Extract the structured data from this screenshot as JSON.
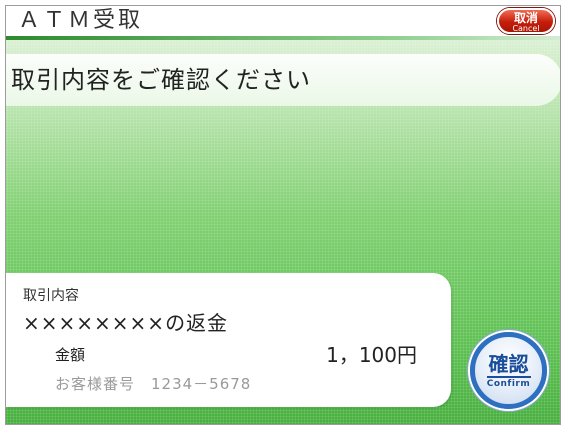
{
  "header": {
    "title": "ＡＴＭ受取",
    "cancel_label": "取消",
    "cancel_sublabel": "Cancel"
  },
  "instruction": "取引内容をご確認ください",
  "detail": {
    "heading": "取引内容",
    "transaction_type": "××××××××の返金",
    "amount_label": "金額",
    "amount_value": "1，100円",
    "customer_number": "お客様番号　1234－5678"
  },
  "confirm": {
    "label": "確認",
    "sublabel": "Confirm"
  },
  "colors": {
    "accent_green": "#5bbf4f",
    "cancel_red": "#c41d0a",
    "confirm_blue": "#2e6fc2"
  }
}
